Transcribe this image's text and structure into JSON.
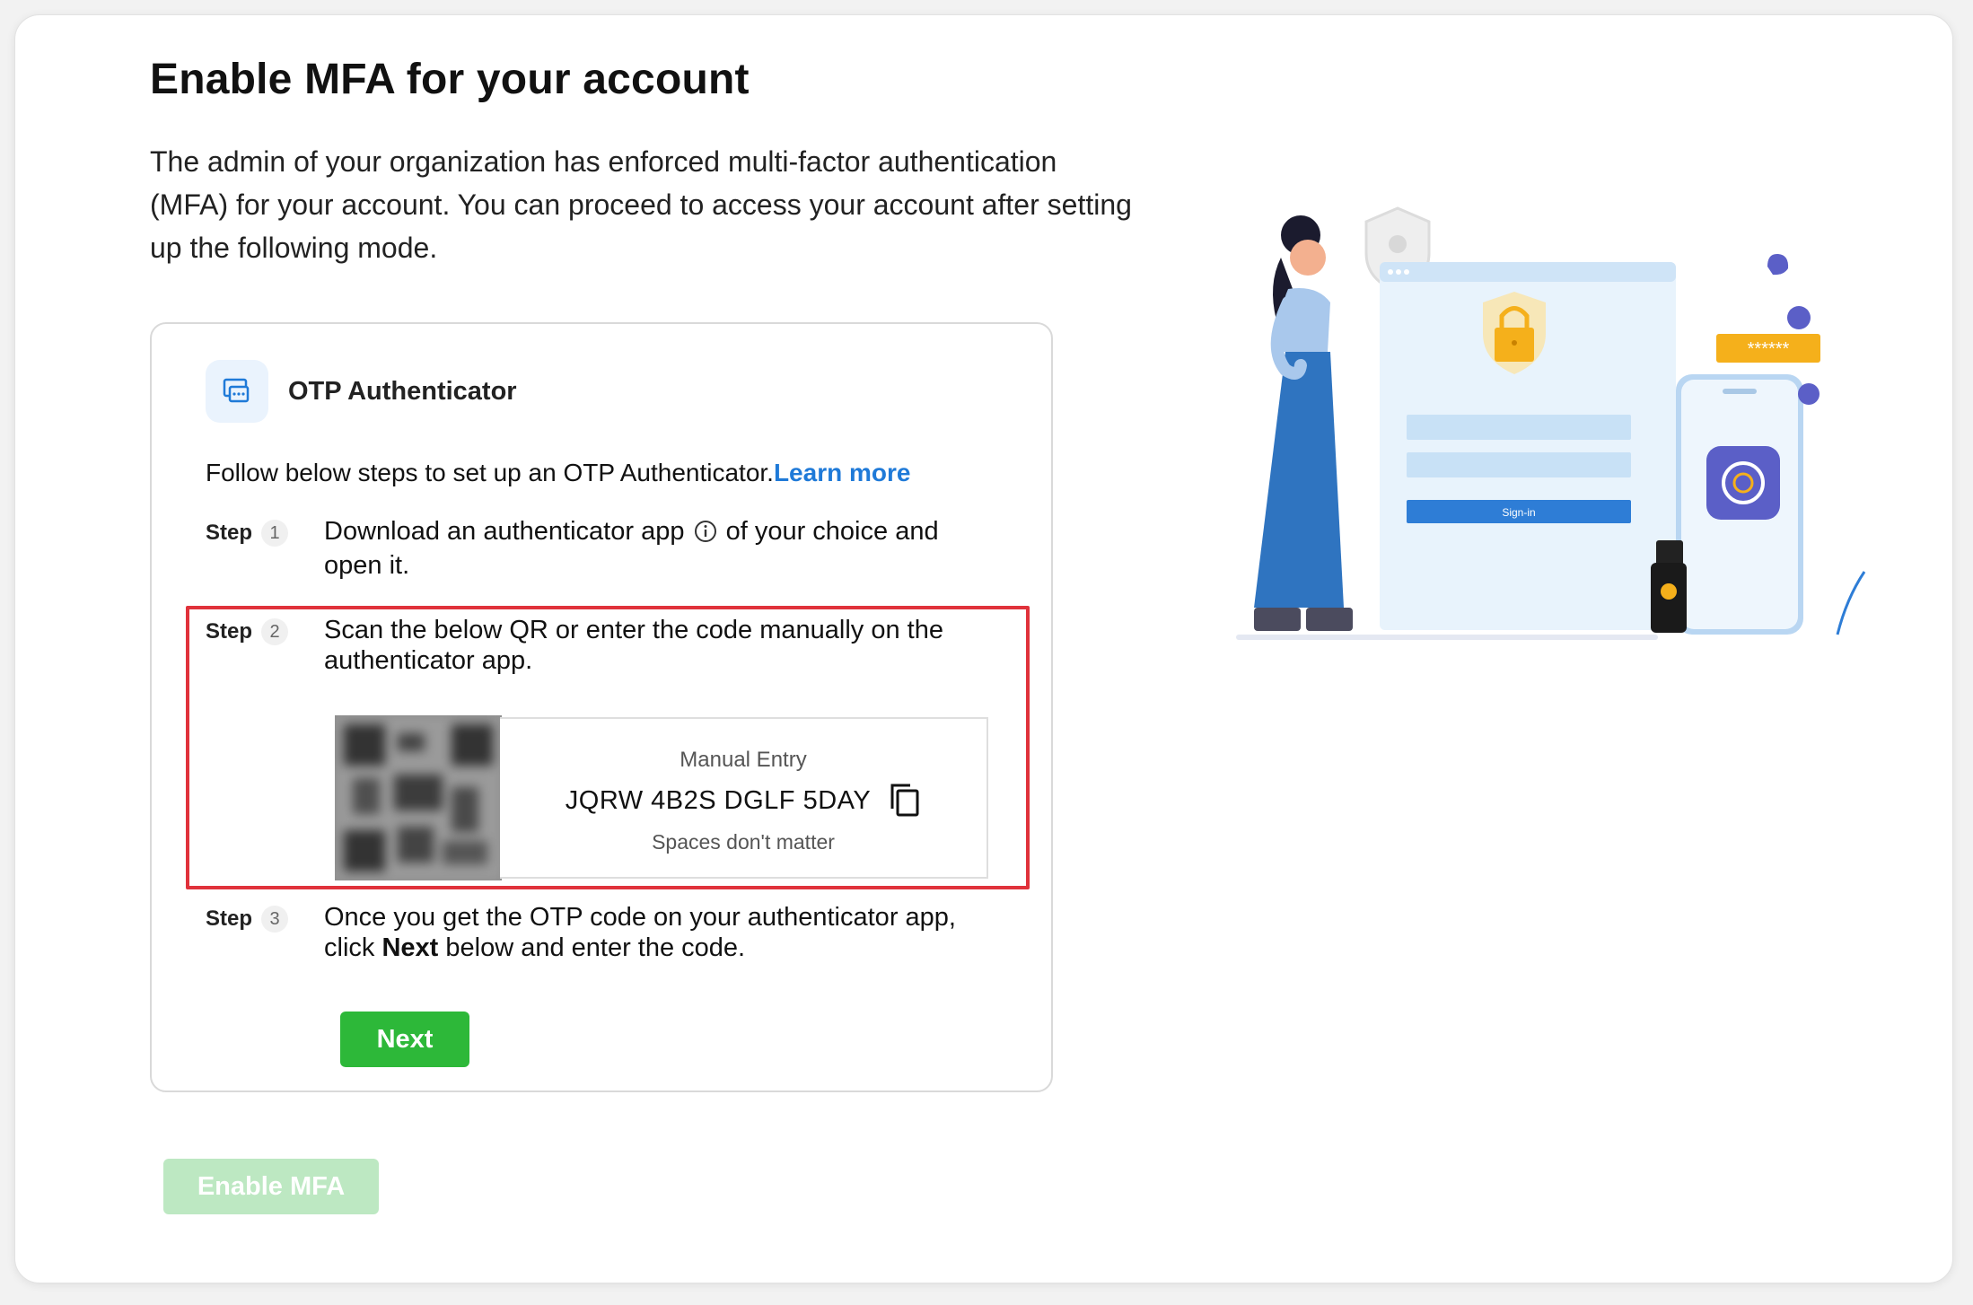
{
  "page": {
    "title": "Enable MFA for your account",
    "intro": "The admin of your organization has enforced multi-factor authentication (MFA) for your account. You can proceed to access your account after setting up the following mode."
  },
  "otp": {
    "title": "OTP Authenticator",
    "follow_text": "Follow below steps to set up an OTP Authenticator.",
    "learn_more": "Learn more",
    "step_label": "Step",
    "steps": [
      {
        "num": "1",
        "text_a": "Download an authenticator app",
        "text_b": " of your choice and open it."
      },
      {
        "num": "2",
        "text": "Scan the below QR or enter the code manually on the authenticator app."
      },
      {
        "num": "3",
        "text_a": "Once you get the OTP code on your authenticator app, click ",
        "text_bold": "Next",
        "text_b": " below and enter the code."
      }
    ],
    "manual_entry": {
      "title": "Manual Entry",
      "code": "JQRW 4B2S DGLF 5DAY",
      "note": "Spaces don't matter"
    },
    "next_label": "Next"
  },
  "enable_label": "Enable MFA",
  "illustration": {
    "signin_label": "Sign-in",
    "password_mask": "******"
  },
  "colors": {
    "link": "#1f7ad8",
    "primary_green": "#2db839",
    "disabled_green": "#bde8c2",
    "highlight": "#e0323b"
  },
  "icons": [
    "otp-authenticator-icon",
    "info-icon",
    "copy-icon",
    "qr-code"
  ]
}
